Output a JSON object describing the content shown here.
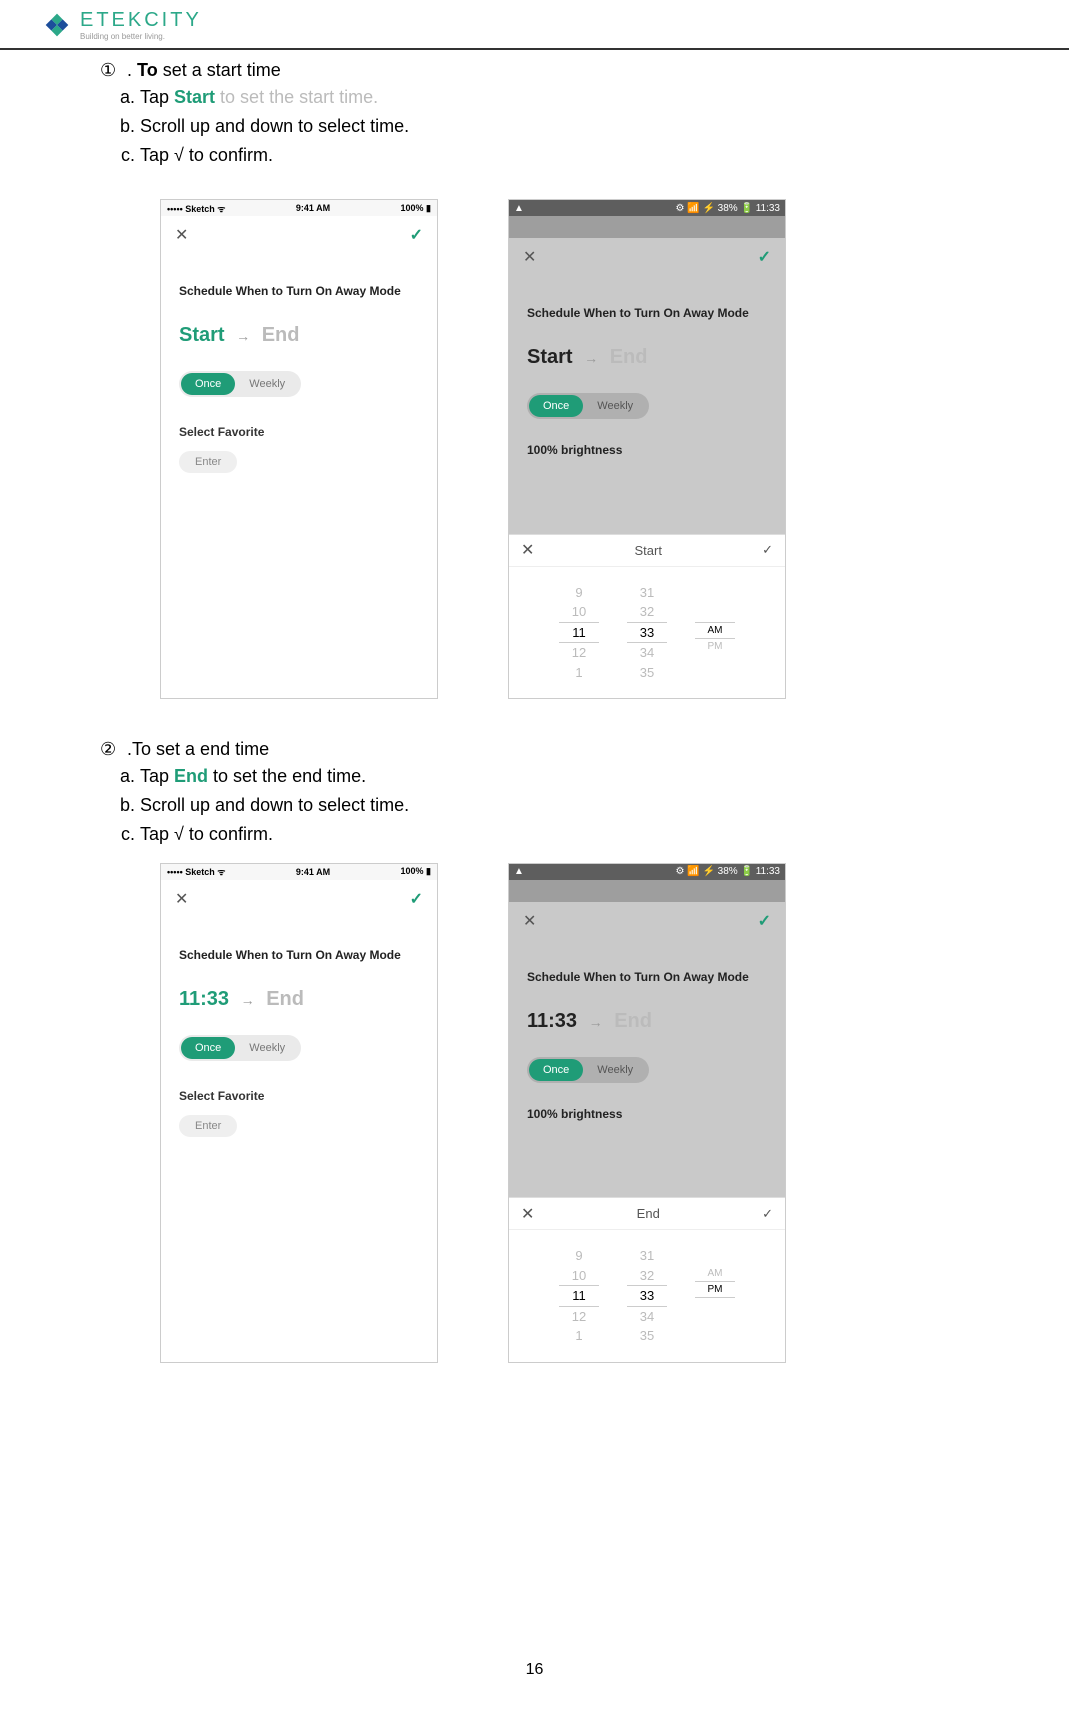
{
  "brand": {
    "name": "ETEKCITY",
    "tagline": "Building on better living."
  },
  "section1": {
    "num": "①",
    "title_prefix": " . ",
    "title_bold": "To",
    "title_rest": " set a start time",
    "a_pre": "Tap ",
    "a_kw": "Start",
    "a_post": " to set the start time.",
    "b": "Scroll up and down to select time.",
    "c_pre": "Tap ",
    "c_symbol": "√",
    "c_post": " to confirm."
  },
  "section2": {
    "num": "②",
    "title": " .To set a end time",
    "a_pre": "Tap ",
    "a_kw": "End",
    "a_post": " to set the end time.",
    "b": "Scroll up and down to select time.",
    "c_pre": "Tap ",
    "c_symbol": "√",
    "c_post": " to confirm."
  },
  "ios_status": {
    "carrier": "••••• Sketch",
    "wifi": "ᯤ",
    "time": "9:41 AM",
    "batt": "100%"
  },
  "android_status": {
    "right": "⚙ 📶 ⚡ 38% 🔋 11:33"
  },
  "screen_common": {
    "close": "✕",
    "check": "✓",
    "sched_title": "Schedule When to Turn On Away Mode",
    "once": "Once",
    "weekly": "Weekly",
    "fav": "Select Favorite",
    "enter": "Enter",
    "bright": "100% brightness",
    "arrow": "→"
  },
  "s1_ios": {
    "start": "Start",
    "end": "End"
  },
  "s1_android": {
    "start": "Start",
    "end": "End",
    "picker_title": "Start",
    "hours": [
      "9",
      "10",
      "11",
      "12",
      "1"
    ],
    "mins": [
      "31",
      "32",
      "33",
      "34",
      "35"
    ],
    "ampm": [
      "AM",
      "PM"
    ],
    "sel_h": "11",
    "sel_m": "33",
    "sel_ap": "AM"
  },
  "s2_ios": {
    "start": "11:33",
    "end": "End"
  },
  "s2_android": {
    "start": "11:33",
    "end": "End",
    "picker_title": "End",
    "hours": [
      "9",
      "10",
      "11",
      "12",
      "1"
    ],
    "mins": [
      "31",
      "32",
      "33",
      "34",
      "35"
    ],
    "ampm": [
      "AM",
      "PM"
    ],
    "sel_h": "11",
    "sel_m": "33",
    "sel_ap": "PM"
  },
  "page_number": "16"
}
